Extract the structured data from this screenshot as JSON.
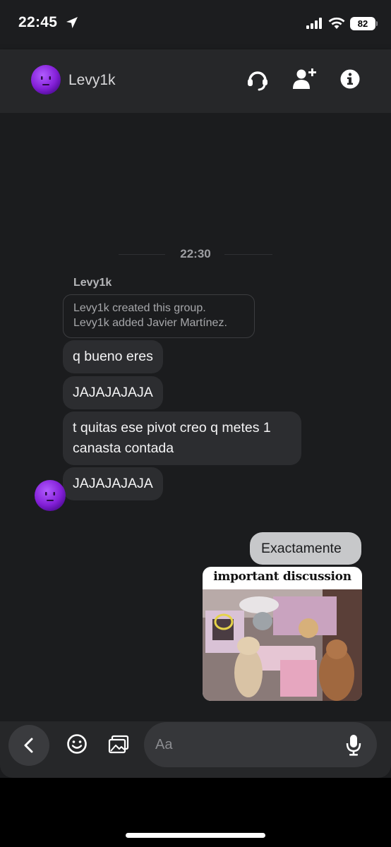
{
  "status_bar": {
    "time": "22:45",
    "battery": "82"
  },
  "header": {
    "title": "Levy1k",
    "icons": [
      "headset-icon",
      "add-friend-icon",
      "info-icon"
    ]
  },
  "conversation": {
    "time_divider": "22:30",
    "sender_name": "Levy1k",
    "system_messages": [
      "Levy1k created this group.",
      "Levy1k added Javier Martínez."
    ],
    "incoming_messages": [
      "q bueno eres",
      "JAJAJAJAJA",
      "t quitas ese pivot creo q metes 1 canasta contada",
      "JAJAJAJAJA"
    ],
    "outgoing_message": "Exactamente",
    "shared_image_caption": "important discussion"
  },
  "composer": {
    "placeholder": "Aa"
  },
  "colors": {
    "background": "#1b1c1e",
    "header": "#262729",
    "incoming_bubble": "#2c2d30",
    "outgoing_bubble": "#c7c8ca",
    "avatar_purple": "#8e2de2"
  }
}
